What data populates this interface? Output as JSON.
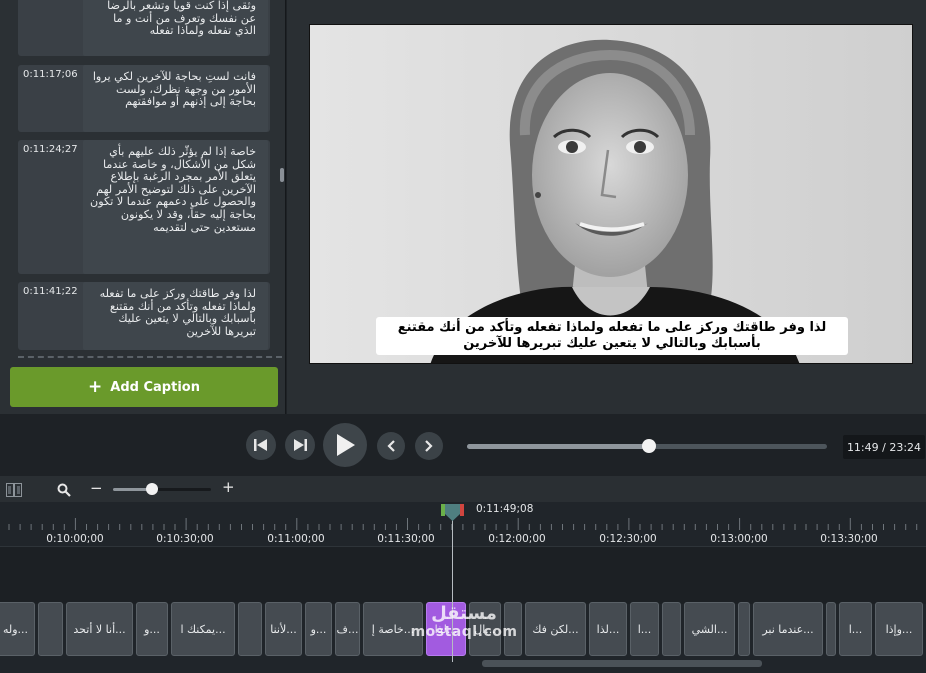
{
  "caption_panel": {
    "captions": [
      {
        "time": "",
        "text": "وثقى إذا كنت قويا وتشعر بالرضا عن نفسك وتعرف من أنت  و ما الذي تفعله ولماذا تفعله"
      },
      {
        "time": "0:11:17;06",
        "text": "فانت لستِ بحاجة للآخرين لكي يروا الأمور من وجهة نظرك، ولست بحاجة إلى إذنهم أو موافقتهم"
      },
      {
        "time": "0:11:24;27",
        "text": "خاصة إذا لم يؤثّر ذلك عليهم بأي شكل من الأشكال، و خاصة عندما يتعلق الأمر بمجرد الرغبة بإطلاع الآخرين على ذلك لتوضيح الأمر لهم والحصول على دعمهم عندما لا تكون بحاجة إليه حقاً، وقد لا يكونون مستعدين حتى لتقديمه"
      },
      {
        "time": "0:11:41;22",
        "text": "لذا وفر طاقتك وركز على ما تفعله ولماذا تفعله وتأكد من أنك مقتنع بأسبابك وبالتالي لا يتعين عليك تبريرها للآخرين"
      }
    ],
    "add_caption_label": "Add Caption"
  },
  "preview": {
    "caption_line": "لذا وفر طاقتك وركز على ما تفعله ولماذا تفعله وتأكد من أنك مقتنع بأسبابك وبالتالي لا يتعين عليك تبريرها للآخرين"
  },
  "player": {
    "time_display": "11:49 / 23:24",
    "progress": 0.505,
    "icons": [
      "previous-frame-icon",
      "step-forward-icon",
      "play-icon",
      "previous-caption-icon",
      "next-caption-icon"
    ]
  },
  "timeline_toolbar": {
    "zoom_level": 0.4,
    "icons": [
      "track-toggle-icon",
      "zoom-icon",
      "zoom-out-icon",
      "zoom-in-icon"
    ]
  },
  "timeline": {
    "playhead_time": "0:11:49;08",
    "ticks": [
      "0:10:00;00",
      "0:10:30;00",
      "0:11:00;00",
      "0:11:30;00",
      "0:12:00;00",
      "0:12:30;00",
      "0:13:00;00",
      "0:13:30;00"
    ],
    "clips": [
      "...وله",
      "",
      "...أنا لا أتحد",
      "...و",
      "...يمكنك ا",
      "",
      "...لأننا",
      "...و",
      "...ف",
      "...خاصة إ",
      "...لذا",
      "...ال",
      "",
      "...لكن فك",
      "...لذا",
      "...ا",
      "",
      "...الشي",
      "",
      "...عندما نبر",
      "",
      "...ا",
      "...وإذا"
    ]
  },
  "colors": {
    "accent_green": "#6a9a2b",
    "selected_clip": "#a25be0",
    "playhead": "#4f7f80"
  },
  "watermark": {
    "arabic": "مستقل",
    "latin": "mostaql.com"
  }
}
